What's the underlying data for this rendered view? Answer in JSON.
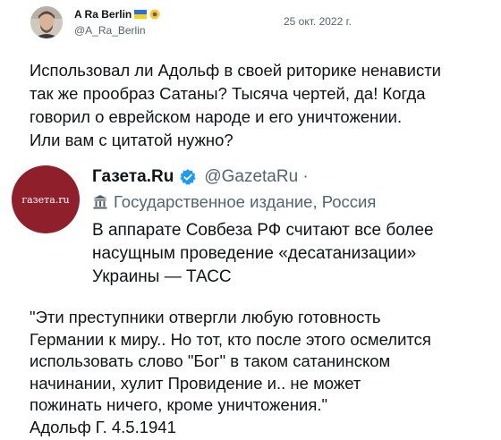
{
  "author": {
    "name": "A Ra Berlin",
    "handle": "@A_Ra_Berlin",
    "flag_icon": "ukraine-flag-icon",
    "emoji_icon": "sunflower-icon"
  },
  "date": "25 окт. 2022 г.",
  "tweet_text": "Использовал ли Адольф в своей риторике ненависти\nтак же прообраз Сатаны? Тысяча чертей, да! Когда\nговорил о еврейском народе и его уничтожении.\nИли вам с цитатой нужно?",
  "quoted": {
    "avatar_text": "газета.ru",
    "name": "Газета.Ru",
    "handle": "@GazetaRu ·",
    "verified_color": "#1d9bf0",
    "label_icon": "state-building-icon",
    "label": "Государственное издание, Россия",
    "text": "В аппарате Совбеза РФ считают все более\nнасущным проведение «десатанизации»\nУкраины — ТАСС"
  },
  "citation": "\"Эти преступники отвергли любую готовность\nГермании к миру.. Но тот, кто после этого осмелится\nиспользовать слово \"Бог\" в таком сатанинском\nначинании, хулит Провидение и.. не может\nпожинать ничего, кроме уничтожения.\"\nАдольф Г. 4.5.1941",
  "colors": {
    "text": "#0f1419",
    "secondary": "#536471",
    "gazeta_brand": "#8e1f2b"
  }
}
